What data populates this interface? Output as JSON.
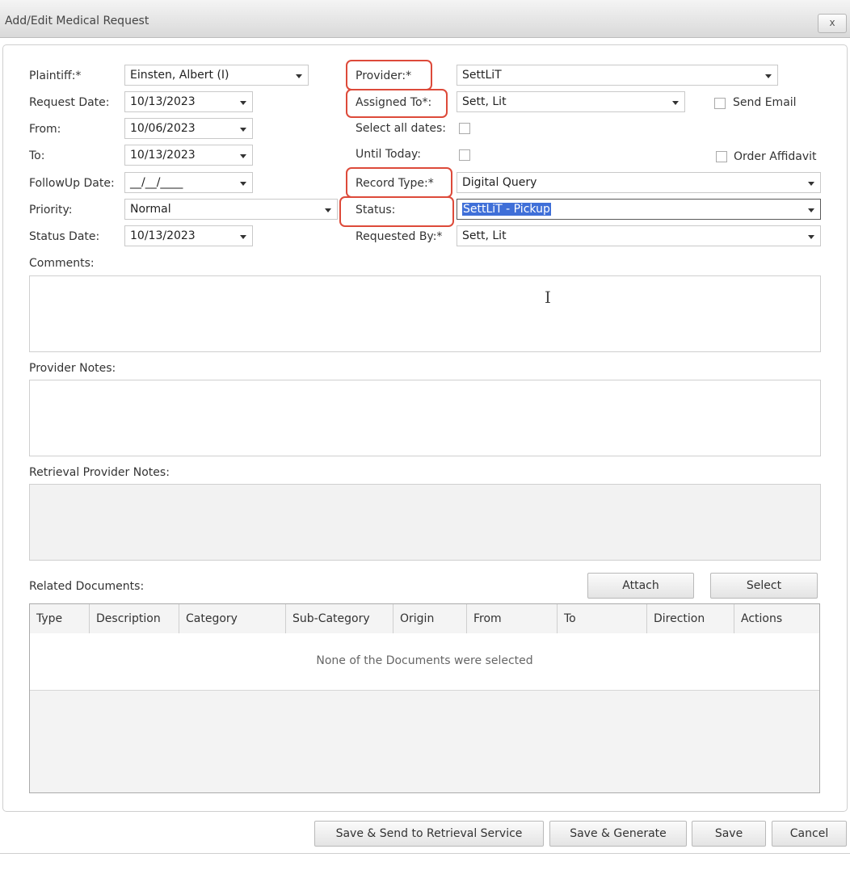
{
  "window": {
    "title": "Add/Edit Medical Request",
    "close_label": "x"
  },
  "left_form": {
    "plaintiff_label": "Plaintiff:*",
    "plaintiff_value": "Einsten, Albert (I)",
    "request_date_label": "Request Date:",
    "request_date_value": "10/13/2023",
    "from_label": "From:",
    "from_value": "10/06/2023",
    "to_label": "To:",
    "to_value": "10/13/2023",
    "followup_label": "FollowUp Date:",
    "followup_value": "__/__/____",
    "priority_label": "Priority:",
    "priority_value": "Normal",
    "status_date_label": "Status Date:",
    "status_date_value": "10/13/2023"
  },
  "right_form": {
    "provider_label": "Provider:*",
    "provider_value": "SettLiT",
    "assigned_to_label": "Assigned To*:",
    "assigned_to_value": "Sett, Lit",
    "send_email_label": "Send Email",
    "select_all_dates_label": "Select all dates:",
    "until_today_label": "Until Today:",
    "order_affidavit_label": "Order Affidavit",
    "record_type_label": "Record Type:*",
    "record_type_value": "Digital Query",
    "status_label": "Status:",
    "status_value": "SettLiT - Pickup",
    "requested_by_label": "Requested By:*",
    "requested_by_value": "Sett, Lit"
  },
  "notes": {
    "comments_label": "Comments:",
    "provider_notes_label": "Provider Notes:",
    "retrieval_notes_label": "Retrieval Provider Notes:"
  },
  "documents": {
    "label": "Related Documents:",
    "attach_label": "Attach",
    "select_label": "Select",
    "columns": [
      "Type",
      "Description",
      "Category",
      "Sub-Category",
      "Origin",
      "From",
      "To",
      "Direction",
      "Actions"
    ],
    "empty_message": "None of the Documents were selected"
  },
  "footer": {
    "save_send_label": "Save & Send to Retrieval Service",
    "save_generate_label": "Save & Generate",
    "save_label": "Save",
    "cancel_label": "Cancel"
  },
  "colors": {
    "highlight": "#dd4a3a",
    "selection": "#3f6fd8"
  },
  "icons": [
    "dropdown-arrow-icon",
    "close-icon",
    "text-cursor-icon"
  ]
}
